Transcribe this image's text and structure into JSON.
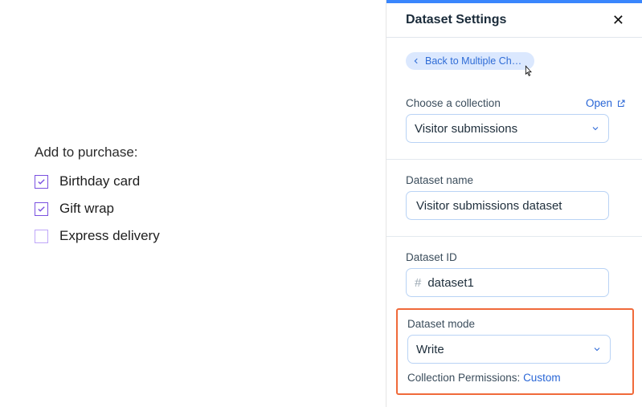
{
  "left": {
    "heading": "Add to purchase:",
    "options": [
      {
        "label": "Birthday card",
        "checked": true
      },
      {
        "label": "Gift wrap",
        "checked": true
      },
      {
        "label": "Express delivery",
        "checked": false
      }
    ]
  },
  "panel": {
    "title": "Dataset Settings",
    "back_chip": "Back to Multiple Choice",
    "collection": {
      "label": "Choose a collection",
      "open": "Open",
      "value": "Visitor submissions"
    },
    "dataset_name": {
      "label": "Dataset name",
      "value": "Visitor submissions dataset"
    },
    "dataset_id": {
      "label": "Dataset ID",
      "prefix": "#",
      "value": "dataset1"
    },
    "dataset_mode": {
      "label": "Dataset mode",
      "value": "Write"
    },
    "permissions": {
      "label": "Collection Permissions: ",
      "value": "Custom"
    }
  }
}
